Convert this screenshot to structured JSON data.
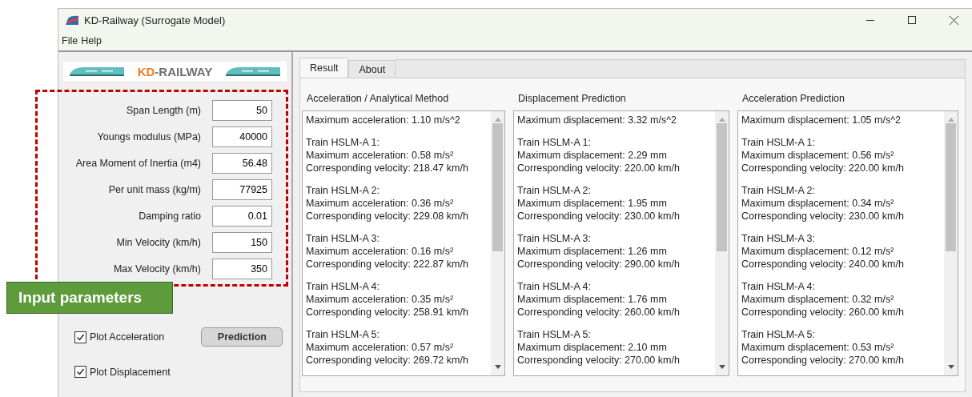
{
  "window": {
    "title": "KD-Railway (Surrogate Model)"
  },
  "menu": [
    "File",
    "Help"
  ],
  "logo": {
    "accent": "KD",
    "rest": "-RAILWAY"
  },
  "annotation": {
    "label": "Input parameters"
  },
  "parameters": [
    {
      "label": "Span Length (m)",
      "value": "50"
    },
    {
      "label": "Youngs modulus (MPa)",
      "value": "40000"
    },
    {
      "label": "Area Moment of Inertia (m4)",
      "value": "56.48"
    },
    {
      "label": "Per unit mass (kg/m)",
      "value": "77925"
    },
    {
      "label": "Damping ratio",
      "value": "0.01"
    },
    {
      "label": "Min Velocity (km/h)",
      "value": "150"
    },
    {
      "label": "Max Velocity (km/h)",
      "value": "350"
    }
  ],
  "options": [
    {
      "label": "Plot Acceleration",
      "checked": true
    },
    {
      "label": "Plot Displacement",
      "checked": true
    }
  ],
  "predict_button": "Prediction",
  "tabs": [
    {
      "label": "Result",
      "selected": true
    },
    {
      "label": "About",
      "selected": false
    }
  ],
  "results": [
    {
      "title": "Acceleration / Analytical Method",
      "summary": "Maximum acceleration: 1.10 m/s^2",
      "trains": [
        [
          "Train HSLM-A 1:",
          "Maximum acceleration: 0.58 m/s²",
          "Corresponding velocity: 218.47 km/h"
        ],
        [
          "Train HSLM-A 2:",
          "Maximum acceleration: 0.36 m/s²",
          "Corresponding velocity: 229.08 km/h"
        ],
        [
          "Train HSLM-A 3:",
          "Maximum acceleration: 0.16 m/s²",
          "Corresponding velocity: 222.87 km/h"
        ],
        [
          "Train HSLM-A 4:",
          "Maximum acceleration: 0.35 m/s²",
          "Corresponding velocity: 258.91 km/h"
        ],
        [
          "Train HSLM-A 5:",
          "Maximum acceleration: 0.57 m/s²",
          "Corresponding velocity: 269.72 km/h"
        ]
      ]
    },
    {
      "title": "Displacement Prediction",
      "summary": "Maximum displacement: 3.32 m/s^2",
      "trains": [
        [
          "Train HSLM-A 1:",
          "Maximum displacement: 2.29 mm",
          "Corresponding velocity: 220.00 km/h"
        ],
        [
          "Train HSLM-A 2:",
          "Maximum displacement: 1.95 mm",
          "Corresponding velocity: 230.00 km/h"
        ],
        [
          "Train HSLM-A 3:",
          "Maximum displacement: 1.26 mm",
          "Corresponding velocity: 290.00 km/h"
        ],
        [
          "Train HSLM-A 4:",
          "Maximum displacement: 1.76 mm",
          "Corresponding velocity: 260.00 km/h"
        ],
        [
          "Train HSLM-A 5:",
          "Maximum displacement: 2.10 mm",
          "Corresponding velocity: 270.00 km/h"
        ]
      ]
    },
    {
      "title": "Acceleration Prediction",
      "summary": "Maximum displacement: 1.05 m/s^2",
      "trains": [
        [
          "Train HSLM-A 1:",
          "Maximum displacement: 0.56 m/s²",
          "Corresponding velocity: 220.00 km/h"
        ],
        [
          "Train HSLM-A 2:",
          "Maximum displacement: 0.34 m/s²",
          "Corresponding velocity: 230.00 km/h"
        ],
        [
          "Train HSLM-A 3:",
          "Maximum displacement: 0.12 m/s²",
          "Corresponding velocity: 240.00 km/h"
        ],
        [
          "Train HSLM-A 4:",
          "Maximum displacement: 0.32 m/s²",
          "Corresponding velocity: 260.00 km/h"
        ],
        [
          "Train HSLM-A 5:",
          "Maximum displacement: 0.53 m/s²",
          "Corresponding velocity: 270.00 km/h"
        ]
      ]
    }
  ]
}
